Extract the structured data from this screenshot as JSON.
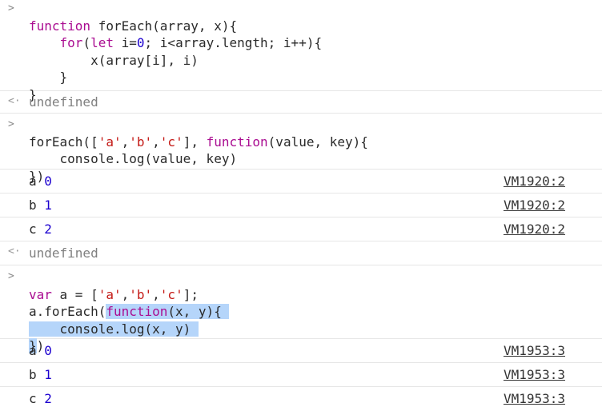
{
  "prompt_symbol": ">",
  "result_symbol": "<·",
  "undefined_text": "undefined",
  "blocks": {
    "b1": {
      "l1": {
        "kw": "function",
        "rest": " forEach(array, x){"
      },
      "l2": {
        "indent": "    ",
        "kw": "for",
        "a": "(",
        "kw2": "let",
        "b": " i=",
        "num": "0",
        "c": "; i<array.length; i++){"
      },
      "l3": {
        "indent": "        ",
        "text": "x(array[i], i)"
      },
      "l4": {
        "indent": "    ",
        "text": "}"
      },
      "l5": {
        "text": "}"
      }
    },
    "b2": {
      "l1": {
        "a": "forEach([",
        "s1": "'a'",
        "c1": ",",
        "s2": "'b'",
        "c2": ",",
        "s3": "'c'",
        "b": "], ",
        "kw": "function",
        "rest": "(value, key){"
      },
      "l2": {
        "indent": "    ",
        "text": "console.log(value, key)"
      },
      "l3": {
        "text": "})"
      }
    },
    "b3": {
      "l1": {
        "kw": "var",
        "a": " a = [",
        "s1": "'a'",
        "c1": ",",
        "s2": "'b'",
        "c2": ",",
        "s3": "'c'",
        "b": "];"
      },
      "l2": {
        "a": "a.forEach(",
        "kw": "function",
        "rest": "(x, y){"
      },
      "l3": {
        "indent": "    ",
        "text": "console.log(x, y)"
      },
      "l4": {
        "a": "}",
        "b": ")"
      }
    }
  },
  "logs1": [
    {
      "key": "a",
      "num": "0",
      "source": "VM1920:2"
    },
    {
      "key": "b",
      "num": "1",
      "source": "VM1920:2"
    },
    {
      "key": "c",
      "num": "2",
      "source": "VM1920:2"
    }
  ],
  "logs2": [
    {
      "key": "a",
      "num": "0",
      "source": "VM1953:3"
    },
    {
      "key": "b",
      "num": "1",
      "source": "VM1953:3"
    },
    {
      "key": "c",
      "num": "2",
      "source": "VM1953:3"
    }
  ],
  "colors": {
    "keyword": "#aa0d91",
    "string": "#c41a16",
    "number": "#1c00cf",
    "selection": "#b5d5fa",
    "link": "#333333"
  }
}
